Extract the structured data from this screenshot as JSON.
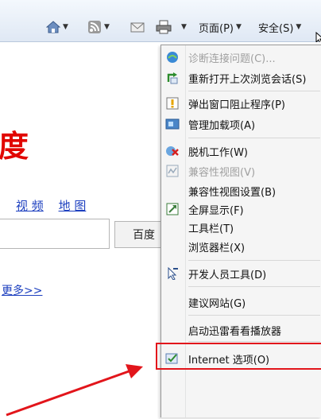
{
  "toolbar": {
    "page_label": "页面(P)",
    "safety_label": "安全(S)"
  },
  "page": {
    "logo_text": "度",
    "links": [
      "视 频",
      "地 图"
    ],
    "search_button": "百度",
    "more_link": "更多>>"
  },
  "menu": {
    "items": [
      {
        "label": "诊断连接问题(C)...",
        "icon": "diagnose-icon",
        "disabled": true
      },
      {
        "label": "重新打开上次浏览会话(S)",
        "icon": "reopen-session-icon",
        "disabled": false
      },
      {
        "label": "弹出窗口阻止程序(P)",
        "icon": "popup-blocker-icon",
        "disabled": false
      },
      {
        "label": "管理加载项(A)",
        "icon": "addons-icon",
        "disabled": false
      },
      {
        "label": "脱机工作(W)",
        "icon": "work-offline-icon",
        "disabled": false
      },
      {
        "label": "兼容性视图(V)",
        "icon": "compat-view-icon",
        "disabled": true
      },
      {
        "label": "兼容性视图设置(B)",
        "icon": "",
        "disabled": false
      },
      {
        "label": "全屏显示(F)",
        "icon": "fullscreen-icon",
        "disabled": false
      },
      {
        "label": "工具栏(T)",
        "icon": "",
        "disabled": false
      },
      {
        "label": "浏览器栏(X)",
        "icon": "",
        "disabled": false
      },
      {
        "label": "开发人员工具(D)",
        "icon": "devtools-icon",
        "disabled": false
      },
      {
        "label": "建议网站(G)",
        "icon": "",
        "disabled": false
      },
      {
        "label": "启动迅雷看看播放器",
        "icon": "",
        "disabled": false
      },
      {
        "label": "Internet 选项(O)",
        "icon": "internet-options-icon",
        "disabled": false
      }
    ]
  },
  "colors": {
    "highlight": "#e2151b",
    "link": "#1c3fbf",
    "logo": "#e10601"
  }
}
